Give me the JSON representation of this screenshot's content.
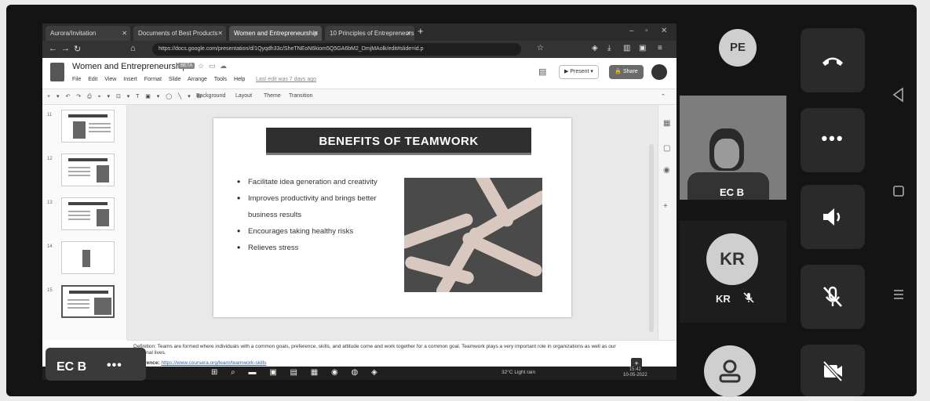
{
  "browser": {
    "tabs": [
      {
        "label": "Aurora/Invitation"
      },
      {
        "label": "Documents of Best Products"
      },
      {
        "label": "Women and Entrepreneurship"
      },
      {
        "label": "10 Principles of Entrepreneurs"
      }
    ],
    "url": "https://docs.google.com/presentation/d/1Qyqdh33c/SheTNEoN6kiom5Q5GA6bM2_DmjMAolk/edit#slide=id.p"
  },
  "slides_app": {
    "doc_title": "Women and Entrepreneurship",
    "beta_badge": "BETA",
    "menu": [
      "File",
      "Edit",
      "View",
      "Insert",
      "Format",
      "Slide",
      "Arrange",
      "Tools",
      "Help"
    ],
    "last_edit": "Last edit was 7 days ago",
    "present_label": "Present",
    "share_label": "Share",
    "toolbar_items": [
      "Background",
      "Layout",
      "Theme",
      "Transition"
    ]
  },
  "slide": {
    "title": "BENEFITS OF TEAMWORK",
    "bullets": [
      "Facilitate idea generation and creativity",
      "Improves productivity and brings better business results",
      "Encourages taking healthy risks",
      "Relieves stress"
    ]
  },
  "notes": {
    "definition": "Definition: Teams are formed where individuals with a common goals, preference, skills, and attitude come and work together for a common goal. Teamwork plays a very important role in organizations as well as our personal lives.",
    "reference_label": "Reference:",
    "reference_url": "https://www.coursera.org/learn/teamwork-skills"
  },
  "taskbar": {
    "weather": "32°C  Light rain",
    "time": "15:42",
    "date": "10-05-2022"
  },
  "meeting": {
    "self_tile_name": "EC B",
    "participants": [
      {
        "initials": "PE"
      },
      {
        "name": "EC B"
      },
      {
        "initials": "KR",
        "name": "KR"
      }
    ]
  },
  "colors": {
    "background_photo": "#ececec",
    "device_frame": "#141414",
    "tile_dark": "#2a2a2a",
    "avatar_grey": "#cfcfcf",
    "slide_title_bar": "#2f2f2f"
  }
}
